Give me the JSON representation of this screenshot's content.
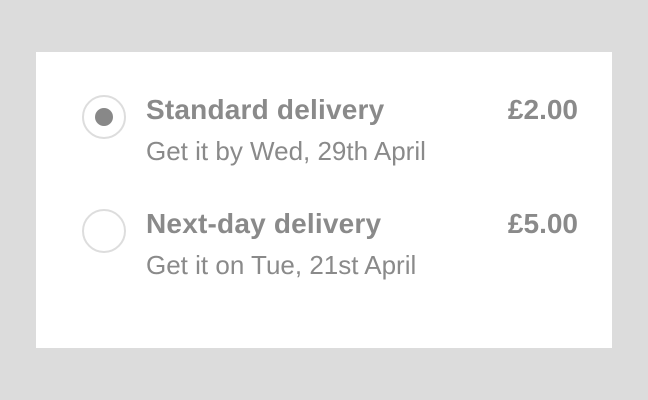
{
  "delivery_options": {
    "selected": "standard",
    "items": [
      {
        "id": "standard",
        "title": "Standard delivery",
        "price": "£2.00",
        "subtitle": "Get it by Wed, 29th April",
        "selected": true
      },
      {
        "id": "next-day",
        "title": "Next-day delivery",
        "price": "£5.00",
        "subtitle": "Get it on Tue, 21st April",
        "selected": false
      }
    ]
  },
  "colors": {
    "page_background": "#dcdcdc",
    "card_background": "#ffffff",
    "text": "#8a8a8a",
    "radio_border": "#dddddd",
    "radio_selected_dot": "#888888"
  }
}
